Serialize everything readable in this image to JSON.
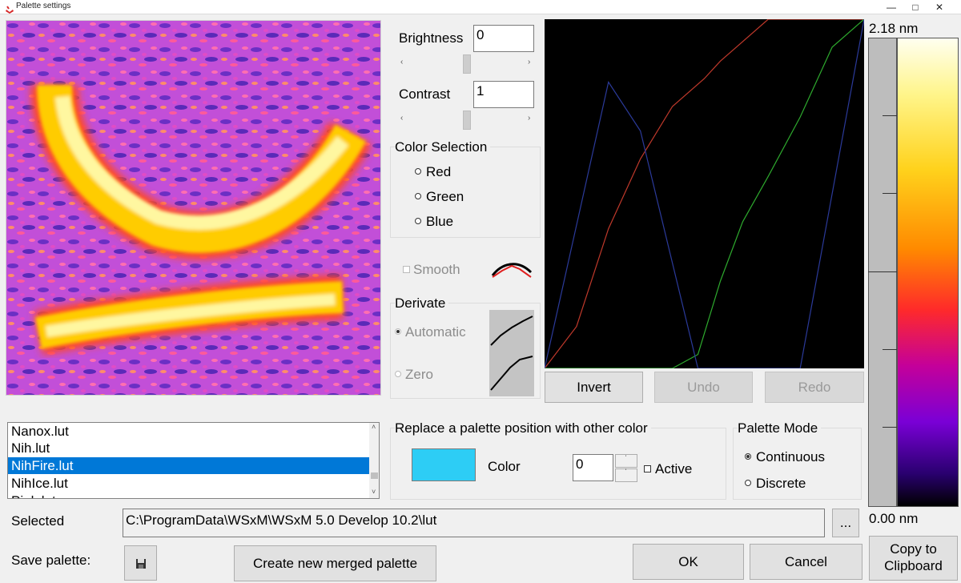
{
  "window": {
    "title": "Palette settings",
    "minimize_icon": "minimize-icon",
    "maximize_icon": "maximize-icon",
    "close_icon": "close-icon"
  },
  "brightness": {
    "label": "Brightness",
    "value": "0",
    "slider_fraction": 0.5
  },
  "contrast": {
    "label": "Contrast",
    "value": "1",
    "slider_fraction": 0.5
  },
  "color_selection": {
    "title": "Color Selection",
    "options": [
      "Red",
      "Green",
      "Blue"
    ]
  },
  "smooth": {
    "label": "Smooth",
    "checked": false,
    "enabled": false
  },
  "derivate": {
    "title": "Derivate",
    "options": [
      "Automatic",
      "Zero"
    ],
    "selected": "Automatic",
    "enabled": false
  },
  "curve_buttons": {
    "invert": "Invert",
    "undo": "Undo",
    "redo": "Redo"
  },
  "palette_files": {
    "items": [
      "Nanox.lut",
      "Nih.lut",
      "NihFire.lut",
      "NihIce.lut",
      "Pink.lut"
    ],
    "selected": "NihFire.lut"
  },
  "replace": {
    "title": "Replace a palette position with other color",
    "color_label": "Color",
    "color_value": "#2dcdf5",
    "position_value": "0",
    "active_label": "Active"
  },
  "palette_mode": {
    "title": "Palette Mode",
    "options": [
      "Continuous",
      "Discrete"
    ],
    "selected": "Continuous"
  },
  "selected": {
    "label": "Selected",
    "path": "C:\\ProgramData\\WSxM\\WSxM 5.0 Develop 10.2\\lut",
    "browse_label": "..."
  },
  "save": {
    "label": "Save palette:",
    "icon": "floppy-disk-icon"
  },
  "buttons": {
    "merge": "Create new merged palette",
    "ok": "OK",
    "cancel": "Cancel",
    "copy": "Copy to Clipboard"
  },
  "color_scale": {
    "max_label": "2.18 nm",
    "min_label": "0.00 nm"
  },
  "colors": {
    "selection_blue": "#0078d7",
    "curve_red": "#c0392b",
    "curve_green": "#2eaa2e",
    "curve_blue": "#2b3a9a"
  },
  "chart_data": {
    "type": "line",
    "xlim": [
      0,
      100
    ],
    "ylim": [
      0,
      100
    ],
    "series": [
      {
        "color": "red",
        "x": [
          0,
          10,
          20,
          30,
          40,
          50,
          55,
          60,
          70,
          80,
          90,
          100
        ],
        "y": [
          0,
          12,
          40,
          60,
          75,
          83,
          88,
          92,
          100,
          100,
          100,
          100
        ]
      },
      {
        "color": "green",
        "x": [
          0,
          40,
          48,
          55,
          62,
          70,
          80,
          90,
          100
        ],
        "y": [
          0,
          0,
          4,
          25,
          42,
          55,
          72,
          92,
          100
        ]
      },
      {
        "color": "blue",
        "x": [
          0,
          20,
          30,
          48,
          55,
          65,
          80,
          100
        ],
        "y": [
          0,
          82,
          68,
          0,
          0,
          0,
          0,
          100
        ]
      }
    ]
  }
}
